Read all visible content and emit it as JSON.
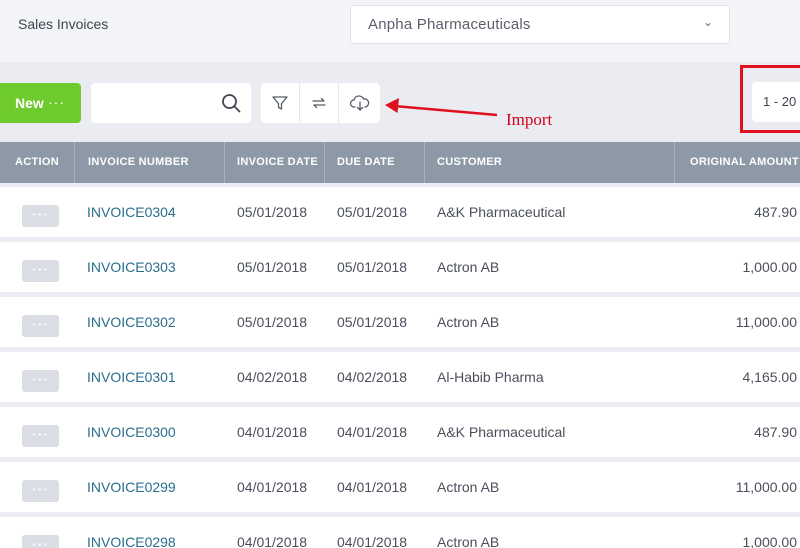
{
  "header": {
    "title": "Sales Invoices",
    "company": "Anpha Pharmaceuticals",
    "chevron_icon": "chevron-down-icon"
  },
  "toolbar": {
    "new_label": "New",
    "new_more": "···",
    "search_placeholder": "",
    "icons": [
      "search-icon",
      "filter-icon",
      "refresh-icon",
      "cloud-download-icon"
    ]
  },
  "annotation": {
    "label": "Import",
    "color": "#d0021b"
  },
  "pagination": {
    "range": "1 - 20"
  },
  "table": {
    "columns": [
      "ACTION",
      "INVOICE NUMBER",
      "INVOICE DATE",
      "DUE DATE",
      "CUSTOMER",
      "ORIGINAL AMOUNT"
    ],
    "rows": [
      {
        "number": "INVOICE0304",
        "date": "05/01/2018",
        "due": "05/01/2018",
        "customer": "A&K Pharmaceutical",
        "amount": "487.90"
      },
      {
        "number": "INVOICE0303",
        "date": "05/01/2018",
        "due": "05/01/2018",
        "customer": "Actron AB",
        "amount": "1,000.00"
      },
      {
        "number": "INVOICE0302",
        "date": "05/01/2018",
        "due": "05/01/2018",
        "customer": "Actron AB",
        "amount": "11,000.00"
      },
      {
        "number": "INVOICE0301",
        "date": "04/02/2018",
        "due": "04/02/2018",
        "customer": "Al-Habib Pharma",
        "amount": "4,165.00"
      },
      {
        "number": "INVOICE0300",
        "date": "04/01/2018",
        "due": "04/01/2018",
        "customer": "A&K Pharmaceutical",
        "amount": "487.90"
      },
      {
        "number": "INVOICE0299",
        "date": "04/01/2018",
        "due": "04/01/2018",
        "customer": "Actron AB",
        "amount": "11,000.00"
      },
      {
        "number": "INVOICE0298",
        "date": "04/01/2018",
        "due": "04/01/2018",
        "customer": "Actron AB",
        "amount": "1,000.00"
      }
    ],
    "action_label": "···"
  },
  "colors": {
    "accent_green": "#6fca2e",
    "header_bg": "#8d99a6",
    "link": "#2a6e8c",
    "highlight": "#e0111f"
  }
}
